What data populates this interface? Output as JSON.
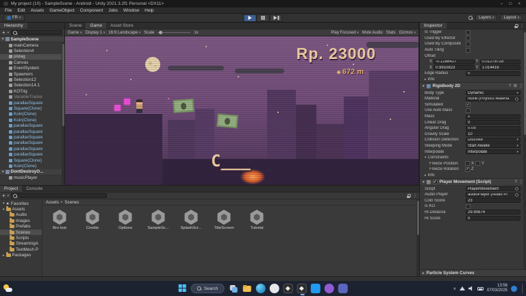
{
  "colors": {
    "play_active": "#3d6091",
    "hud_text": "#f3cfa0",
    "coin_pink": "#ef4fd8",
    "sky_top": "#7d5983",
    "taskbar_bg": "#1c2230"
  },
  "window": {
    "title": "My project (10) - SampleScene - Android - Unity 2021.3.2f1 Personal <DX11>",
    "controls": {
      "min": "–",
      "max": "□",
      "close": "×"
    }
  },
  "menu": {
    "items": [
      {
        "label": "File"
      },
      {
        "label": "Edit"
      },
      {
        "label": "Assets"
      },
      {
        "label": "GameObject"
      },
      {
        "label": "Component"
      },
      {
        "label": "Jobs"
      },
      {
        "label": "Window"
      },
      {
        "label": "Help"
      }
    ]
  },
  "toolbar": {
    "account": "FR",
    "layers": "Layers",
    "layout": "Layout"
  },
  "hierarchy": {
    "tab": "Hierarchy",
    "add_button": "+",
    "scene_root": "SampleScene",
    "items": [
      {
        "label": "mainCamera"
      },
      {
        "label": "Selection4"
      },
      {
        "label": "pistag",
        "state": "selected"
      },
      {
        "label": "Canvas"
      },
      {
        "label": "EventSystem"
      },
      {
        "label": "Spawners"
      },
      {
        "label": "Selection12"
      },
      {
        "label": "Selection14.1"
      },
      {
        "label": "KOTrig"
      },
      {
        "label": "VariableTracke",
        "state": "dim"
      },
      {
        "label": "parallaxSquare",
        "state": "prefab"
      },
      {
        "label": "Square(Clone)",
        "state": "prefab"
      },
      {
        "label": "Koin(Clone)",
        "state": "prefab"
      },
      {
        "label": "Koin(Clone)",
        "state": "prefab"
      },
      {
        "label": "parallaxSquare",
        "state": "prefab"
      },
      {
        "label": "parallaxSquare",
        "state": "prefab"
      },
      {
        "label": "parallaxSquare",
        "state": "prefab"
      },
      {
        "label": "parallaxSquare",
        "state": "prefab"
      },
      {
        "label": "parallaxSquare",
        "state": "prefab"
      },
      {
        "label": "parallaxSquare",
        "state": "prefab"
      },
      {
        "label": "Square(Clone)",
        "state": "prefab"
      },
      {
        "label": "Koin(Clone)",
        "state": "prefab"
      }
    ],
    "dontdestroy_root": "DontDestroyO...",
    "dontdestroy_items": [
      {
        "label": "musicPlayer"
      }
    ]
  },
  "center": {
    "tabs": [
      {
        "label": "Scene"
      },
      {
        "label": "Game",
        "state": "active"
      },
      {
        "label": "Asset Store"
      }
    ],
    "game_toolbar": {
      "view_menu": "Game",
      "display": "Display 1",
      "aspect": "16:9 Landscape",
      "scale_label": "Scale",
      "scale_value": "1x",
      "play_focused": "Play Focused",
      "mute_audio": "Mute Audio",
      "stats": "Stats",
      "gizmos": "Gizmos"
    },
    "hud": {
      "score": "Rp. 23000",
      "distance": "672 m",
      "combo": "C___"
    }
  },
  "inspector": {
    "tab": "Inspector",
    "checks": {
      "simulated": "✓",
      "freeze_z": "✓",
      "pm_enabled": "✓"
    },
    "collider": {
      "is_trigger": "Is Trigger",
      "used_by_effector": "Used By Effector",
      "used_by_composite": "Used By Composite",
      "auto_tiling": "Auto Tiling",
      "offset_label": "Offset",
      "x_label": "X",
      "y_label": "Y",
      "offset_x": "-0.1288427",
      "offset_y": "0.01278728",
      "size_x": "0.9910823",
      "size_y": "1.014416",
      "edge_radius_label": "Edge Radius",
      "edge_radius": "0",
      "info_label": "Info"
    },
    "rigidbody": {
      "title": "Rigidbody 2D",
      "body_type_label": "Body Type",
      "body_type": "Dynamic",
      "material_label": "Material",
      "material": "None (Physics Materia",
      "simulated_label": "Simulated",
      "use_auto_mass_label": "Use Auto Mass",
      "mass_label": "Mass",
      "mass": "1",
      "linear_drag_label": "Linear Drag",
      "linear_drag": "0",
      "angular_drag_label": "Angular Drag",
      "angular_drag": "0.05",
      "gravity_scale_label": "Gravity Scale",
      "gravity_scale": "10",
      "collision_detection_label": "Collision Detection",
      "collision_detection": "Discrete",
      "sleeping_mode_label": "Sleeping Mode",
      "sleeping_mode": "Start Awake",
      "interpolate_label": "Interpolate",
      "interpolate": "Interpolate",
      "constraints_label": "Constraints",
      "freeze_position_label": "Freeze Position",
      "freeze_rotation_label": "Freeze Rotation",
      "axis_x": "X",
      "axis_y": "Y",
      "axis_z": "Z",
      "info_label": "Info"
    },
    "player_movement": {
      "title": "Player Movement (Script)",
      "script_label": "Script",
      "script": "PlayerMovement",
      "audio_player_label": "Audio Player",
      "audio_player": "audioPlayer (Audio Pl",
      "coin_score_label": "Coin Score",
      "coin_score": "23",
      "is_ko_label": "Is KO",
      "hi_distance_label": "Hi Distance",
      "hi_distance": "29.90874",
      "hi_score_label": "Hi Score",
      "hi_score": "0"
    },
    "particle_curves": "Particle System Curves"
  },
  "project": {
    "tabs": [
      {
        "label": "Project",
        "state": "active"
      },
      {
        "label": "Console"
      }
    ],
    "add_button": "+",
    "favorites_label": "Favorites",
    "assets_label": "Assets",
    "folders": [
      {
        "label": "Audio"
      },
      {
        "label": "Images"
      },
      {
        "label": "Prefabs"
      },
      {
        "label": "Scenes",
        "state": "selected"
      },
      {
        "label": "Scripts"
      },
      {
        "label": "StreamingA"
      },
      {
        "label": "TextMesh P"
      }
    ],
    "packages_label": "Packages",
    "breadcrumb": {
      "root": "Assets",
      "separator": "▸",
      "current": "Scenes"
    },
    "scenes": [
      {
        "label": "Bro lost"
      },
      {
        "label": "Credits"
      },
      {
        "label": "Options"
      },
      {
        "label": "SampleSc..."
      },
      {
        "label": "SplashScr..."
      },
      {
        "label": "TitleScreen"
      },
      {
        "label": "Tutorial"
      }
    ]
  },
  "taskbar": {
    "search": "Search",
    "time": "13:56",
    "date": "07/03/2025"
  }
}
